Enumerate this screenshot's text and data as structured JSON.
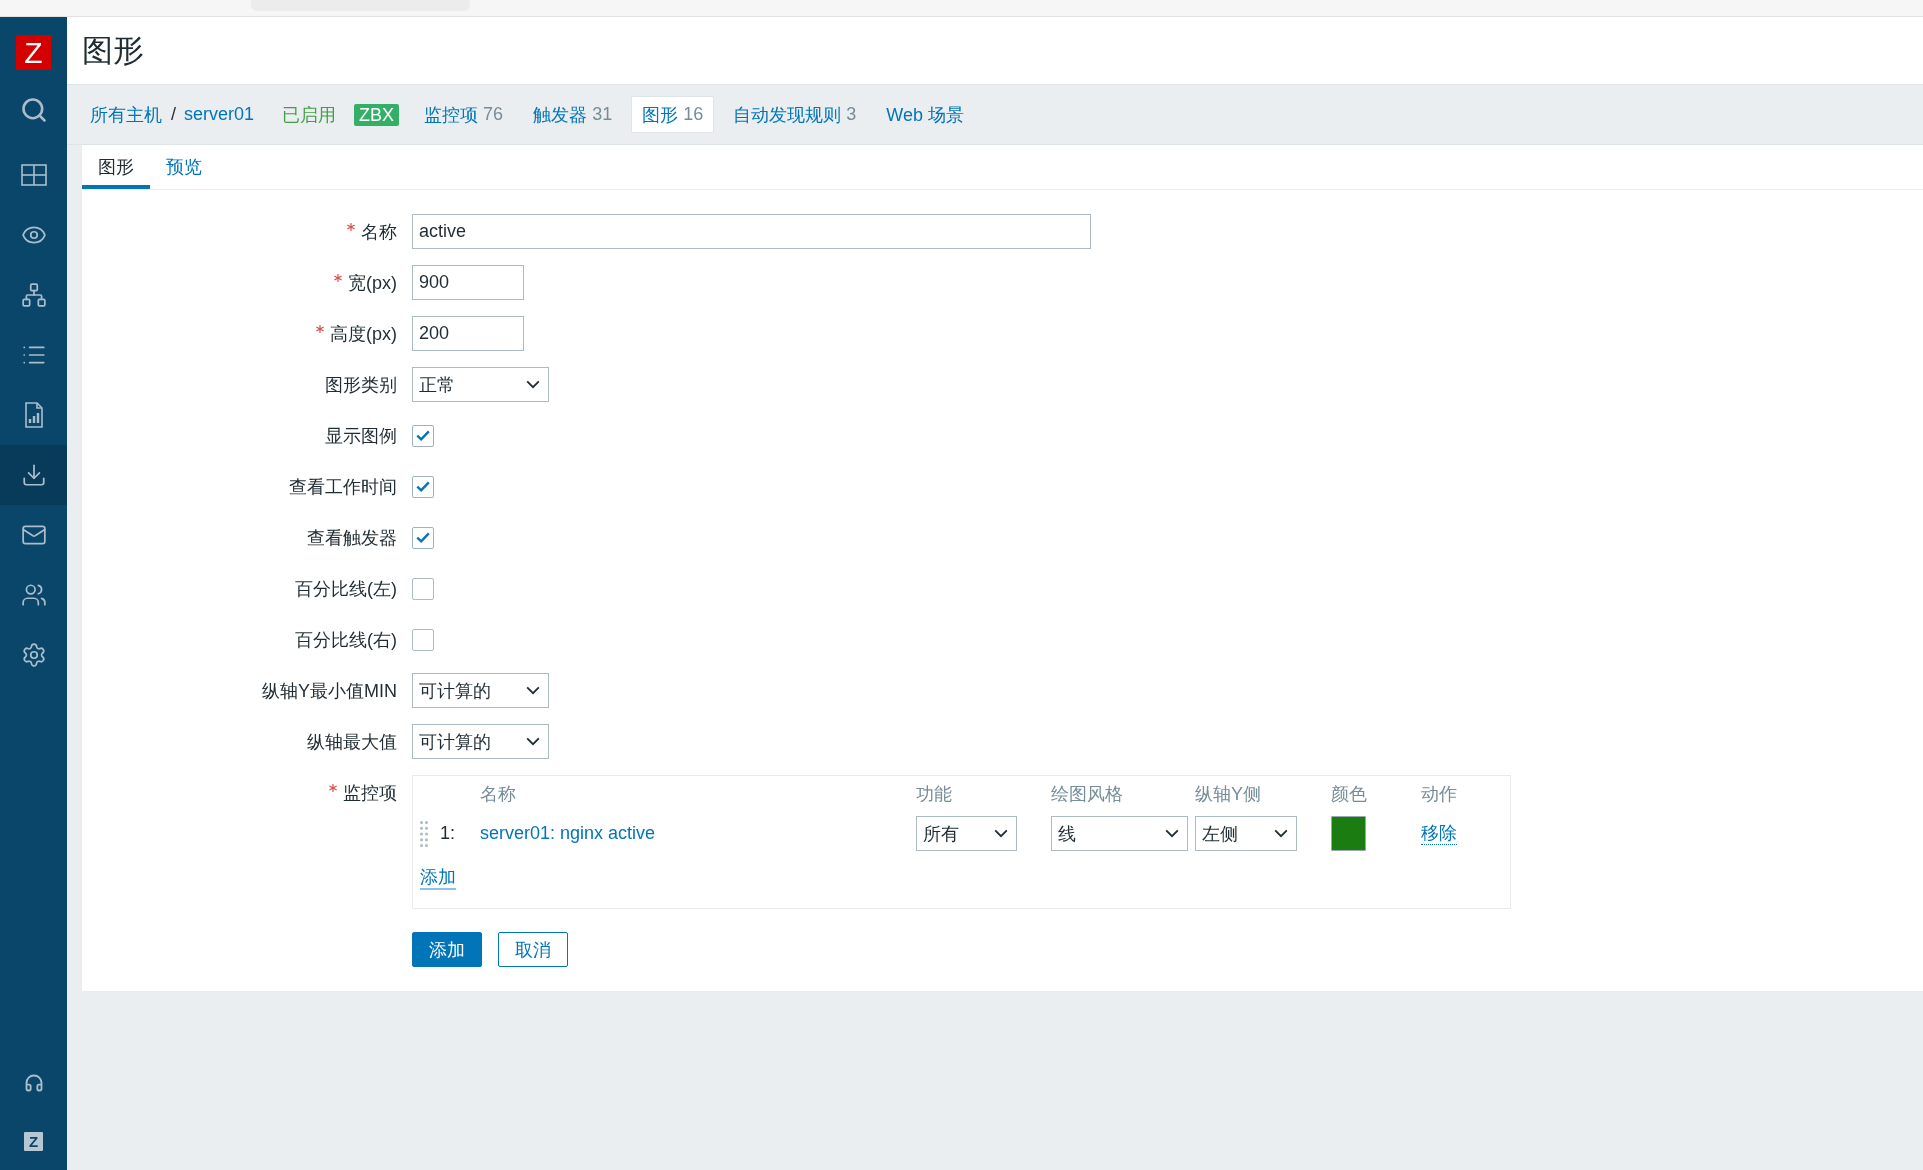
{
  "sidebar": {
    "logo": "Z",
    "items": [
      {
        "selected": false
      },
      {
        "selected": false
      },
      {
        "selected": false
      },
      {
        "selected": false
      },
      {
        "selected": false
      },
      {
        "selected": true
      },
      {
        "selected": false
      },
      {
        "selected": false
      },
      {
        "selected": false
      }
    ],
    "footer_badge": "Z"
  },
  "header": {
    "title": "图形"
  },
  "host_nav": {
    "breadcrumbs": [
      "所有主机",
      "server01"
    ],
    "separator": "/",
    "status": "已启用",
    "badges": [
      "ZBX"
    ],
    "links": [
      {
        "label": "监控项",
        "count": "76",
        "selected": false
      },
      {
        "label": "触发器",
        "count": "31",
        "selected": false
      },
      {
        "label": "图形",
        "count": "16",
        "selected": true
      },
      {
        "label": "自动发现规则",
        "count": "3",
        "selected": false
      },
      {
        "label": "Web 场景",
        "selected": false
      }
    ]
  },
  "tabs": [
    {
      "label": "图形",
      "selected": true
    },
    {
      "label": "预览",
      "selected": false
    }
  ],
  "form": {
    "fields": [
      {
        "kind": "text",
        "label": "名称",
        "required": true,
        "value": "active"
      },
      {
        "kind": "number",
        "label": "宽(px)",
        "required": true,
        "value": "900"
      },
      {
        "kind": "number",
        "label": "高度(px)",
        "required": true,
        "value": "200"
      },
      {
        "kind": "select",
        "label": "图形类别",
        "required": false,
        "value": "正常"
      },
      {
        "kind": "checkbox",
        "label": "显示图例",
        "required": false,
        "checked": true
      },
      {
        "kind": "checkbox",
        "label": "查看工作时间",
        "required": false,
        "checked": true
      },
      {
        "kind": "checkbox",
        "label": "查看触发器",
        "required": false,
        "checked": true
      },
      {
        "kind": "checkbox",
        "label": "百分比线(左)",
        "required": false,
        "checked": false
      },
      {
        "kind": "checkbox",
        "label": "百分比线(右)",
        "required": false,
        "checked": false
      },
      {
        "kind": "select",
        "label": "纵轴Y最小值MIN",
        "required": false,
        "value": "可计算的"
      },
      {
        "kind": "select",
        "label": "纵轴最大值",
        "required": false,
        "value": "可计算的"
      }
    ],
    "items": {
      "label": "监控项",
      "required": true,
      "columns": [
        "名称",
        "功能",
        "绘图风格",
        "纵轴Y侧",
        "颜色",
        "动作"
      ],
      "rows": [
        {
          "number": "1:",
          "name": "server01: nginx active",
          "function": "所有",
          "draw_style": "线",
          "y_axis_side": "左侧",
          "color": "#1a7c11",
          "action": "移除"
        }
      ],
      "add_label": "添加"
    },
    "buttons": [
      {
        "kind": "primary",
        "label": "添加"
      },
      {
        "kind": "secondary",
        "label": "取消"
      }
    ]
  }
}
